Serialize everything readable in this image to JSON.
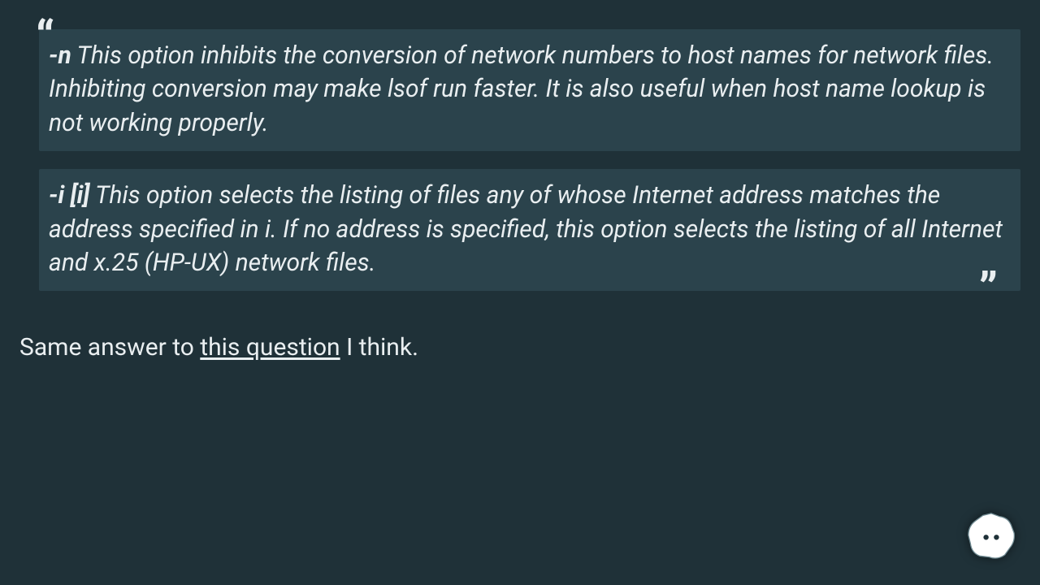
{
  "blockquote": {
    "items": [
      {
        "flag": "-n",
        "text": " This option inhibits the conversion of network numbers to host names for network files. Inhibiting conversion may make lsof run faster. It is also useful when host name lookup is not working properly."
      },
      {
        "flag": "-i [i]",
        "text": " This option selects the listing of files any of whose Internet address matches the address specified in i. If no address is specified, this option selects the listing of all Internet and x.25 (HP-UX) network files."
      }
    ]
  },
  "answer": {
    "before_link": "Same answer to ",
    "link_text": "this question",
    "after_link": " I think."
  }
}
